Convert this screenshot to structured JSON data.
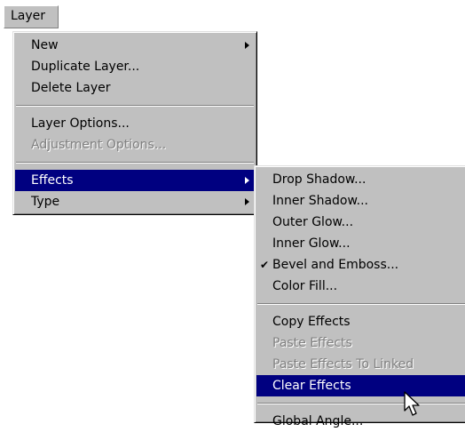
{
  "menubar": {
    "layer_label": "Layer"
  },
  "layer_menu": {
    "new": "New",
    "duplicate_layer": "Duplicate Layer...",
    "delete_layer": "Delete Layer",
    "layer_options": "Layer Options...",
    "adjustment_options": "Adjustment Options...",
    "effects": "Effects",
    "type": "Type"
  },
  "effects_submenu": {
    "drop_shadow": "Drop Shadow...",
    "inner_shadow": "Inner Shadow...",
    "outer_glow": "Outer Glow...",
    "inner_glow": "Inner Glow...",
    "bevel_and_emboss": "Bevel and Emboss...",
    "bevel_checked": "✔",
    "color_fill": "Color Fill...",
    "copy_effects": "Copy Effects",
    "paste_effects": "Paste Effects",
    "paste_effects_to_linked": "Paste Effects To Linked",
    "clear_effects": "Clear Effects",
    "global_angle": "Global Angle..."
  },
  "colors": {
    "highlight": "#000080",
    "menu_bg": "#c0c0c0"
  },
  "icons": {
    "cursor": "arrow-cursor-icon",
    "submenu_arrow": "submenu-arrow-icon",
    "check": "check-icon"
  }
}
